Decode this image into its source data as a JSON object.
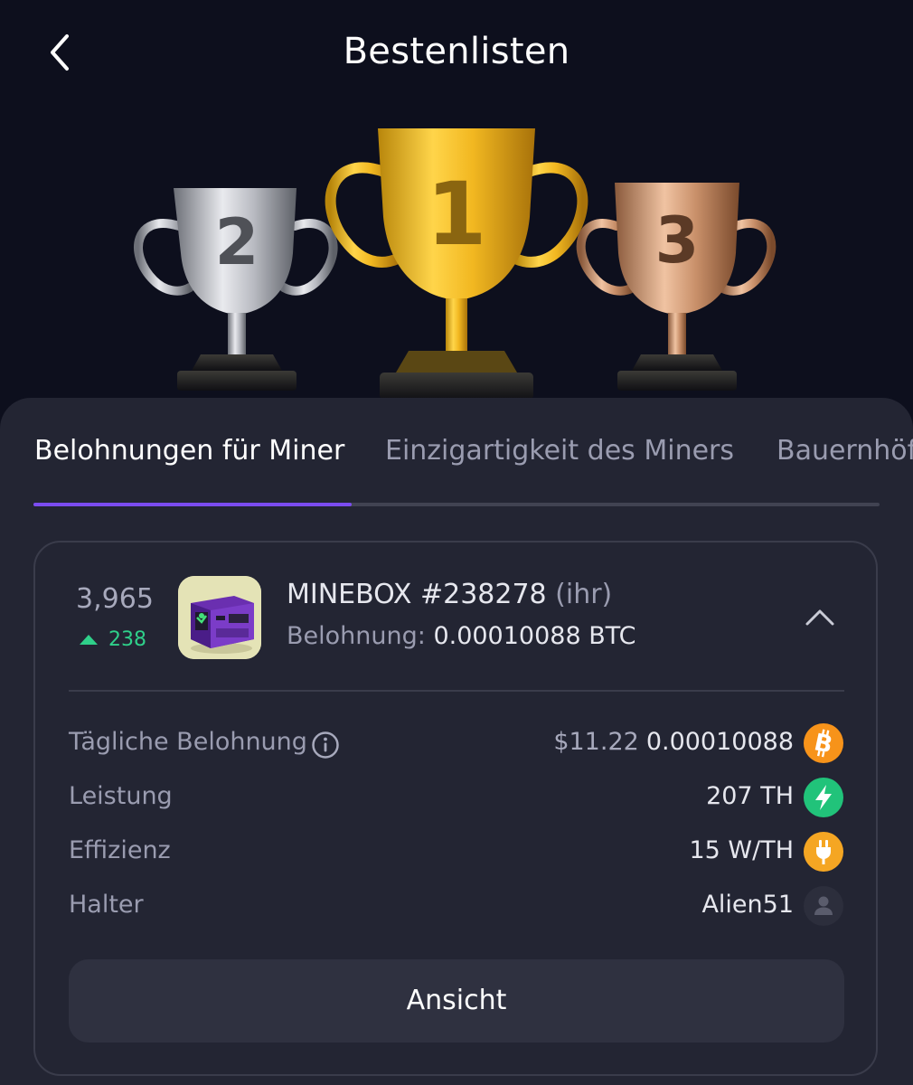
{
  "header": {
    "title": "Bestenlisten",
    "back_icon": "chevron-left-icon"
  },
  "trophies": [
    {
      "rank": "2",
      "material": "silver"
    },
    {
      "rank": "1",
      "material": "gold"
    },
    {
      "rank": "3",
      "material": "bronze"
    }
  ],
  "tabs": [
    {
      "label": "Belohnungen für Miner",
      "active": true
    },
    {
      "label": "Einzigartigkeit des Miners",
      "active": false
    },
    {
      "label": "Bauernhöfe",
      "active": false
    }
  ],
  "card": {
    "rank": "3,965",
    "rank_change": "238",
    "miner_name": "MINEBOX #238278",
    "owner_tag": "(ihr)",
    "reward_label": "Belohnung:",
    "reward_value": "0.00010088 BTC",
    "rows": [
      {
        "label": "Tägliche Belohnung",
        "usd": "$11.22",
        "value": "0.00010088",
        "icon": "bitcoin-icon"
      },
      {
        "label": "Leistung",
        "value": "207 TH",
        "icon": "lightning-icon"
      },
      {
        "label": "Effizienz",
        "value": "15 W/TH",
        "icon": "plug-icon"
      },
      {
        "label": "Halter",
        "value": "Alien51",
        "icon": "user-icon"
      }
    ],
    "view_button": "Ansicht"
  },
  "colors": {
    "background": "#0d0f1d",
    "sheet": "#232533",
    "accent": "#7b4cf0",
    "positive": "#2fd08a",
    "bitcoin": "#f7931a",
    "power": "#21c37a",
    "efficiency": "#f5a623"
  }
}
